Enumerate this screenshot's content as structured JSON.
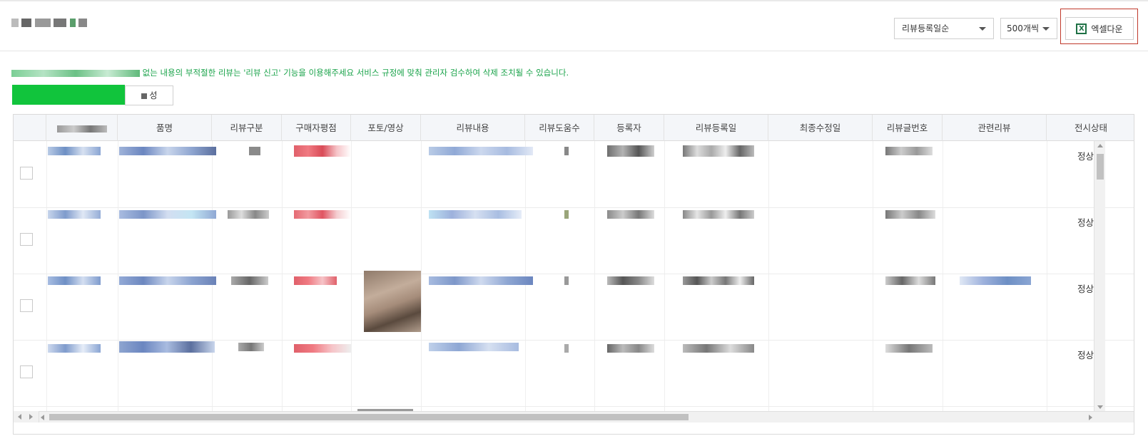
{
  "header": {
    "sort_select": {
      "selected": "리뷰등록일순"
    },
    "per_page_select": {
      "selected": "500개씩"
    },
    "excel_button": {
      "icon": "excel-icon",
      "icon_glyph": "X",
      "label": "엑셀다운"
    }
  },
  "notice": {
    "text": "없는 내용의 부적절한 리뷰는 '리뷰 신고' 기능을 이용해주세요 서비스 규정에 맞춰 관리자 검수하여 삭제 조치될 수 있습니다.",
    "color": "#1aa34a"
  },
  "actions": {
    "primary_color": "#11c43c",
    "secondary_label": "성"
  },
  "table": {
    "columns": [
      "품명",
      "리뷰구분",
      "구매자평점",
      "포토/영상",
      "리뷰내용",
      "리뷰도움수",
      "등록자",
      "리뷰등록일",
      "최종수정일",
      "리뷰글번호",
      "관련리뷰",
      "전시상태"
    ],
    "rows": [
      {
        "status": "정상"
      },
      {
        "status": "정상"
      },
      {
        "status": "정상"
      },
      {
        "status": "정상"
      }
    ]
  }
}
